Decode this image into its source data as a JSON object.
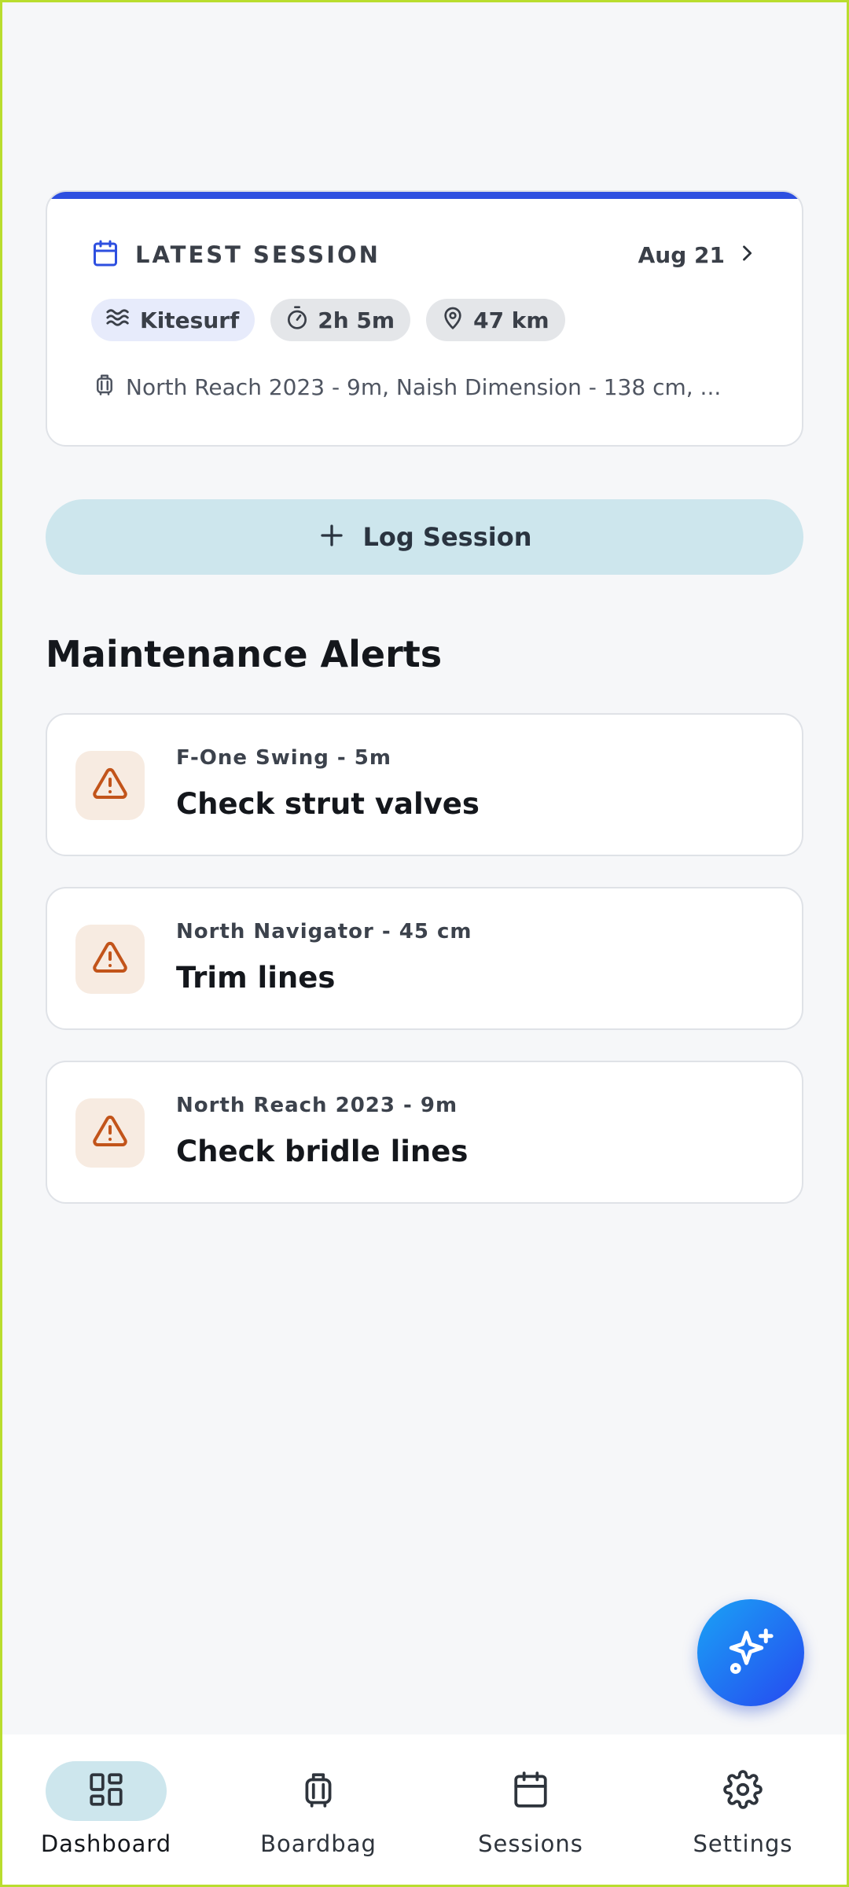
{
  "latest_session": {
    "title": "LATEST SESSION",
    "date": "Aug 21",
    "sport": "Kitesurf",
    "duration": "2h 5m",
    "distance": "47 km",
    "gear": "North Reach 2023 - 9m, Naish Dimension - 138 cm, ..."
  },
  "log_button": {
    "label": "Log Session"
  },
  "maintenance": {
    "title": "Maintenance Alerts",
    "alerts": [
      {
        "item": "F-One Swing - 5m",
        "task": "Check strut valves"
      },
      {
        "item": "North Navigator - 45 cm",
        "task": "Trim lines"
      },
      {
        "item": "North Reach 2023 - 9m",
        "task": "Check bridle lines"
      }
    ]
  },
  "fab": {
    "icon": "sparkles-icon"
  },
  "nav": {
    "items": [
      {
        "label": "Dashboard",
        "icon": "dashboard-icon",
        "active": true
      },
      {
        "label": "Boardbag",
        "icon": "luggage-icon",
        "active": false
      },
      {
        "label": "Sessions",
        "icon": "calendar-icon",
        "active": false
      },
      {
        "label": "Settings",
        "icon": "gear-icon",
        "active": false
      }
    ]
  },
  "colors": {
    "accent": "#2d4fe0",
    "button_bg": "#cde6ed",
    "warning": "#c2541a",
    "warning_bg": "#f7ebe1"
  }
}
